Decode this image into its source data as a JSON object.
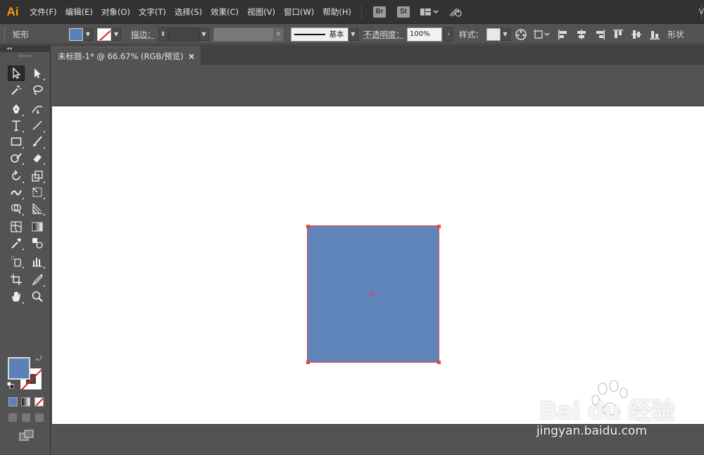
{
  "app": {
    "logo": "Ai"
  },
  "menu": {
    "items": [
      "文件(F)",
      "编辑(E)",
      "对象(O)",
      "文字(T)",
      "选择(S)",
      "效果(C)",
      "视图(V)",
      "窗口(W)",
      "帮助(H)"
    ],
    "bridge": "Br",
    "stock": "St",
    "right_label": "V"
  },
  "control": {
    "tool_name": "矩形",
    "fill_color": "#5b82b8",
    "stroke_label": "描边：",
    "stroke_style_label": "基本",
    "opacity_label": "不透明度：",
    "opacity_value": "100%",
    "style_label": "样式：",
    "shape_label": "形状"
  },
  "document": {
    "tab_title": "未标题-1* @ 66.67% (RGB/预览)",
    "close_glyph": "×"
  },
  "canvas": {
    "shape_fill": "#5f84b9",
    "selection_color": "#e8454a"
  },
  "watermark": {
    "logo": "Bai du 经验",
    "url": "jingyan.baidu.com"
  },
  "tools": [
    "selection-tool",
    "direct-selection-tool",
    "magic-wand-tool",
    "lasso-tool",
    "pen-tool",
    "curvature-tool",
    "type-tool",
    "line-segment-tool",
    "rectangle-tool",
    "paintbrush-tool",
    "shaper-tool",
    "eraser-tool",
    "rotate-tool",
    "scale-tool",
    "width-tool",
    "free-transform-tool",
    "shape-builder-tool",
    "perspective-grid-tool",
    "mesh-tool",
    "gradient-tool",
    "eyedropper-tool",
    "blend-tool",
    "symbol-sprayer-tool",
    "column-graph-tool",
    "artboard-tool",
    "slice-tool",
    "hand-tool",
    "zoom-tool"
  ]
}
